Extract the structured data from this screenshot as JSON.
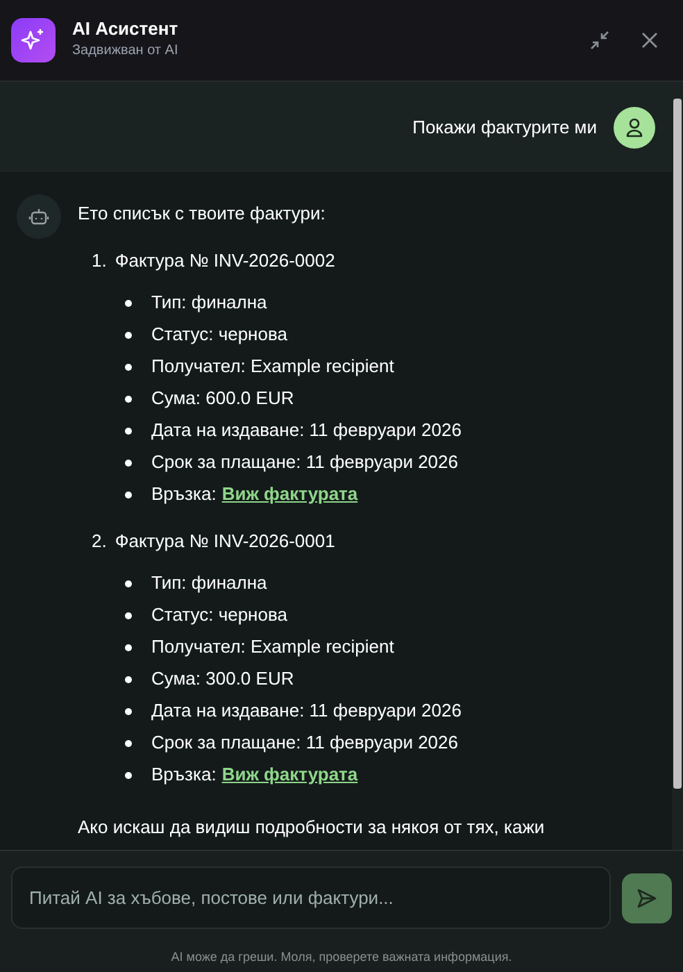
{
  "header": {
    "title": "AI Асистент",
    "subtitle": "Задвижван от AI"
  },
  "user_message": {
    "text": "Покажи фактурите ми"
  },
  "assistant_message": {
    "intro": "Ето списък с твоите фактури:",
    "invoices": [
      {
        "number": "1.",
        "title": "Фактура № INV-2026-0002",
        "details": [
          {
            "kind": "text",
            "text": "Тип: финална"
          },
          {
            "kind": "text",
            "text": "Статус: чернова"
          },
          {
            "kind": "text",
            "text": "Получател: Example recipient"
          },
          {
            "kind": "text",
            "text": "Сума: 600.0 EUR"
          },
          {
            "kind": "text",
            "text": "Дата на издаване: 11 февруари 2026"
          },
          {
            "kind": "text",
            "text": "Срок за плащане: 11 февруари 2026"
          },
          {
            "kind": "link",
            "text": "Връзка:",
            "link": "Виж фактурата"
          }
        ]
      },
      {
        "number": "2.",
        "title": "Фактура № INV-2026-0001",
        "details": [
          {
            "kind": "text",
            "text": "Тип: финална"
          },
          {
            "kind": "text",
            "text": "Статус: чернова"
          },
          {
            "kind": "text",
            "text": "Получател: Example recipient"
          },
          {
            "kind": "text",
            "text": "Сума: 300.0 EUR"
          },
          {
            "kind": "text",
            "text": "Дата на издаване: 11 февруари 2026"
          },
          {
            "kind": "text",
            "text": "Срок за плащане: 11 февруари 2026"
          },
          {
            "kind": "link",
            "text": "Връзка:",
            "link": "Виж фактурата"
          }
        ]
      }
    ],
    "closing": "Ако искаш да видиш подробности за някоя от тях, кажи"
  },
  "input": {
    "placeholder": "Питай AI за хъбове, постове или фактури..."
  },
  "footer": "AI може да греши. Моля, проверете важната информация."
}
